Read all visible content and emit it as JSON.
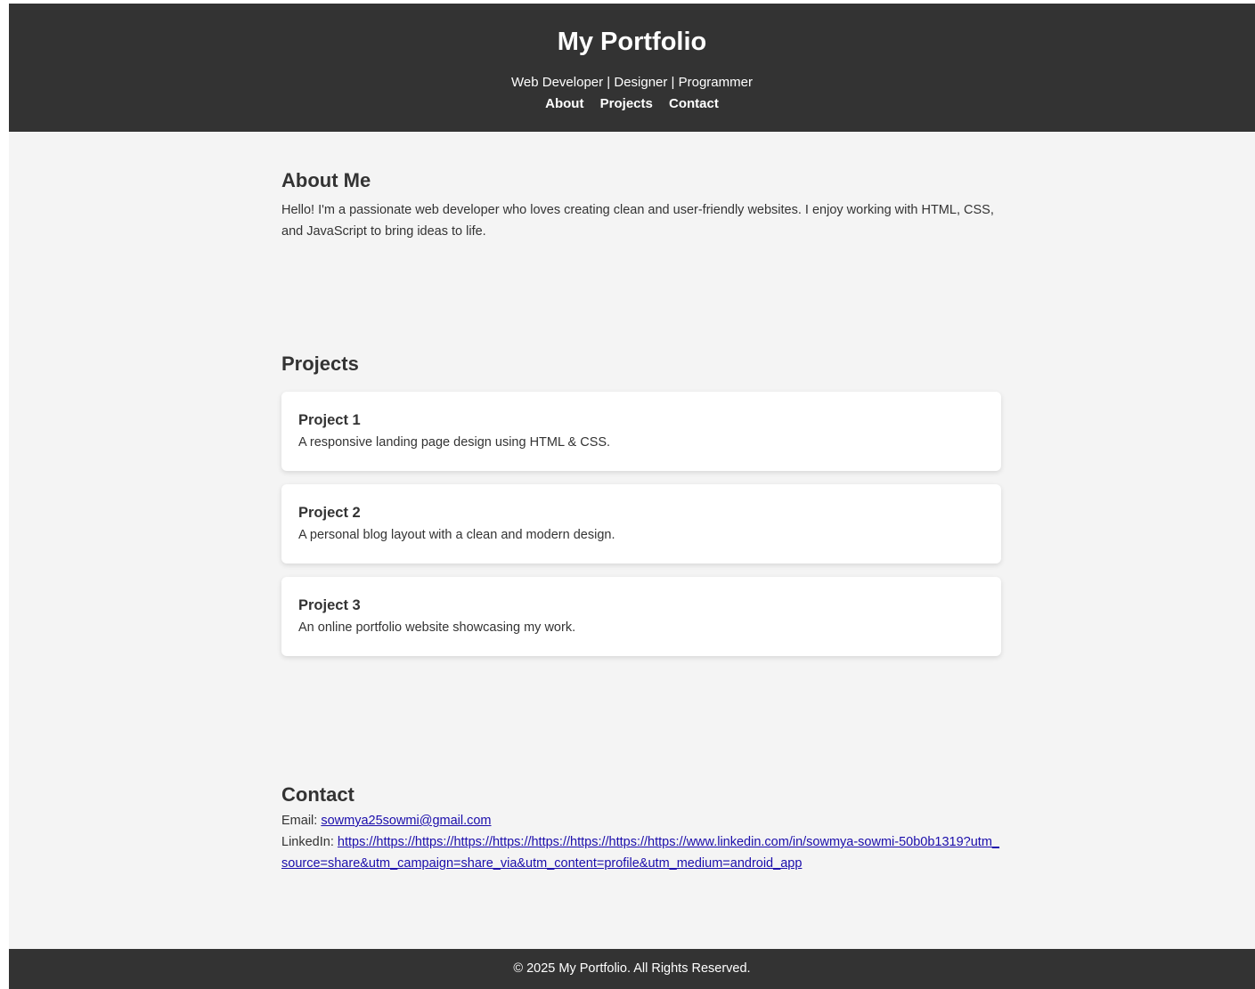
{
  "header": {
    "title": "My Portfolio",
    "tagline": "Web Developer | Designer | Programmer",
    "nav": [
      {
        "label": "About"
      },
      {
        "label": "Projects"
      },
      {
        "label": "Contact"
      }
    ]
  },
  "about": {
    "heading": "About Me",
    "text": "Hello! I'm a passionate web developer who loves creating clean and user-friendly websites. I enjoy working with HTML, CSS, and JavaScript to bring ideas to life."
  },
  "projects": {
    "heading": "Projects",
    "items": [
      {
        "title": "Project 1",
        "description": "A responsive landing page design using HTML & CSS."
      },
      {
        "title": "Project 2",
        "description": "A personal blog layout with a clean and modern design."
      },
      {
        "title": "Project 3",
        "description": "An online portfolio website showcasing my work."
      }
    ]
  },
  "contact": {
    "heading": "Contact",
    "email_label": "Email:",
    "email": "sowmya25sowmi@gmail.com",
    "linkedin_label": "LinkedIn:",
    "linkedin": "https://https://https://https://https://https://https://https://https://www.linkedin.com/in/sowmya-sowmi-50b0b1319?utm_source=share&utm_campaign=share_via&utm_content=profile&utm_medium=android_app"
  },
  "footer": {
    "text": "© 2025 My Portfolio. All Rights Reserved."
  },
  "colors": {
    "header_bg": "#333333",
    "page_bg": "#f4f4f4",
    "card_bg": "#ffffff",
    "link": "#1a0dab"
  }
}
